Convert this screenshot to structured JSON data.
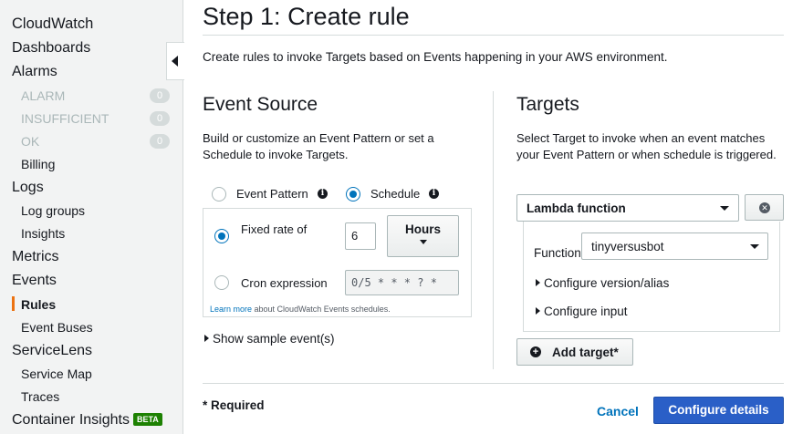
{
  "sidebar": {
    "items": [
      {
        "label": "CloudWatch"
      },
      {
        "label": "Dashboards"
      },
      {
        "label": "Alarms"
      },
      {
        "label": "ALARM",
        "count": "0"
      },
      {
        "label": "INSUFFICIENT",
        "count": "0"
      },
      {
        "label": "OK",
        "count": "0"
      },
      {
        "label": "Billing"
      },
      {
        "label": "Logs"
      },
      {
        "label": "Log groups"
      },
      {
        "label": "Insights"
      },
      {
        "label": "Metrics"
      },
      {
        "label": "Events"
      },
      {
        "label": "Rules"
      },
      {
        "label": "Event Buses"
      },
      {
        "label": "ServiceLens"
      },
      {
        "label": "Service Map"
      },
      {
        "label": "Traces"
      },
      {
        "label": "Container Insights",
        "badge": "BETA"
      }
    ],
    "active_item": "Rules",
    "collapse_icon": "caret-left-icon"
  },
  "page": {
    "title": "Step 1: Create rule",
    "intro": "Create rules to invoke Targets based on Events happening in your AWS environment."
  },
  "event_source": {
    "title": "Event Source",
    "description": "Build or customize an Event Pattern or set a Schedule to invoke Targets.",
    "option_pattern": "Event Pattern",
    "option_schedule": "Schedule",
    "selected": "Schedule",
    "fixed_rate_label": "Fixed rate of",
    "fixed_rate_value": "6",
    "fixed_rate_unit": "Hours",
    "cron_label": "Cron expression",
    "cron_value": "0/5 * * * ? *",
    "learn_more_link": "Learn more",
    "learn_more_text": " about CloudWatch Events schedules.",
    "show_sample": "Show sample event(s)"
  },
  "targets": {
    "title": "Targets",
    "description": "Select Target to invoke when an event matches your Event Pattern or when schedule is triggered.",
    "target_type": "Lambda function",
    "function_label": "Function",
    "function_value": "tinyversusbot",
    "configure_version": "Configure version/alias",
    "configure_input": "Configure input",
    "add_target": "Add target*"
  },
  "footer": {
    "required": "* Required",
    "cancel": "Cancel",
    "configure_details": "Configure details"
  },
  "colors": {
    "accent": "#0073bb",
    "primary_button": "#2a5fc7",
    "active_indicator": "#ec7211",
    "beta_badge": "#1d8102"
  }
}
